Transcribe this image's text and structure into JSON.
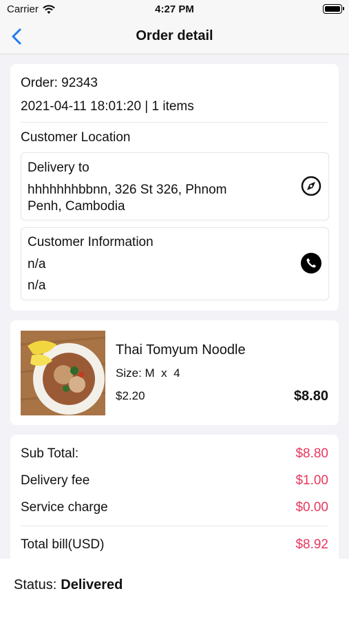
{
  "status_bar": {
    "carrier": "Carrier",
    "time": "4:27 PM"
  },
  "nav": {
    "title": "Order detail"
  },
  "order": {
    "number_line": "Order: 92343",
    "meta_line": "2021-04-11 18:01:20 | 1 items"
  },
  "customer_location": {
    "heading": "Customer Location",
    "delivery_label": "Delivery to",
    "address_line1": "hhhhhhhbbnn, 326 St 326, Phnom",
    "address_line2": "Penh, Cambodia"
  },
  "customer_info": {
    "heading": "Customer Information",
    "name": "n/a",
    "phone": "n/a"
  },
  "item": {
    "name": "Thai Tomyum Noodle",
    "size_qty": "Size: M  x  4",
    "unit_price": "$2.20",
    "line_total": "$8.80"
  },
  "totals": {
    "subtotal_label": "Sub Total:",
    "subtotal_value": "$8.80",
    "delivery_label": "Delivery fee",
    "delivery_value": "$1.00",
    "service_label": "Service charge",
    "service_value": "$0.00",
    "total_label": "Total bill(USD)",
    "total_value": "$8.92"
  },
  "footer": {
    "status_label": "Status:",
    "status_value": "Delivered"
  },
  "colors": {
    "accent": "#1a7cf5",
    "price": "#e8365d"
  }
}
